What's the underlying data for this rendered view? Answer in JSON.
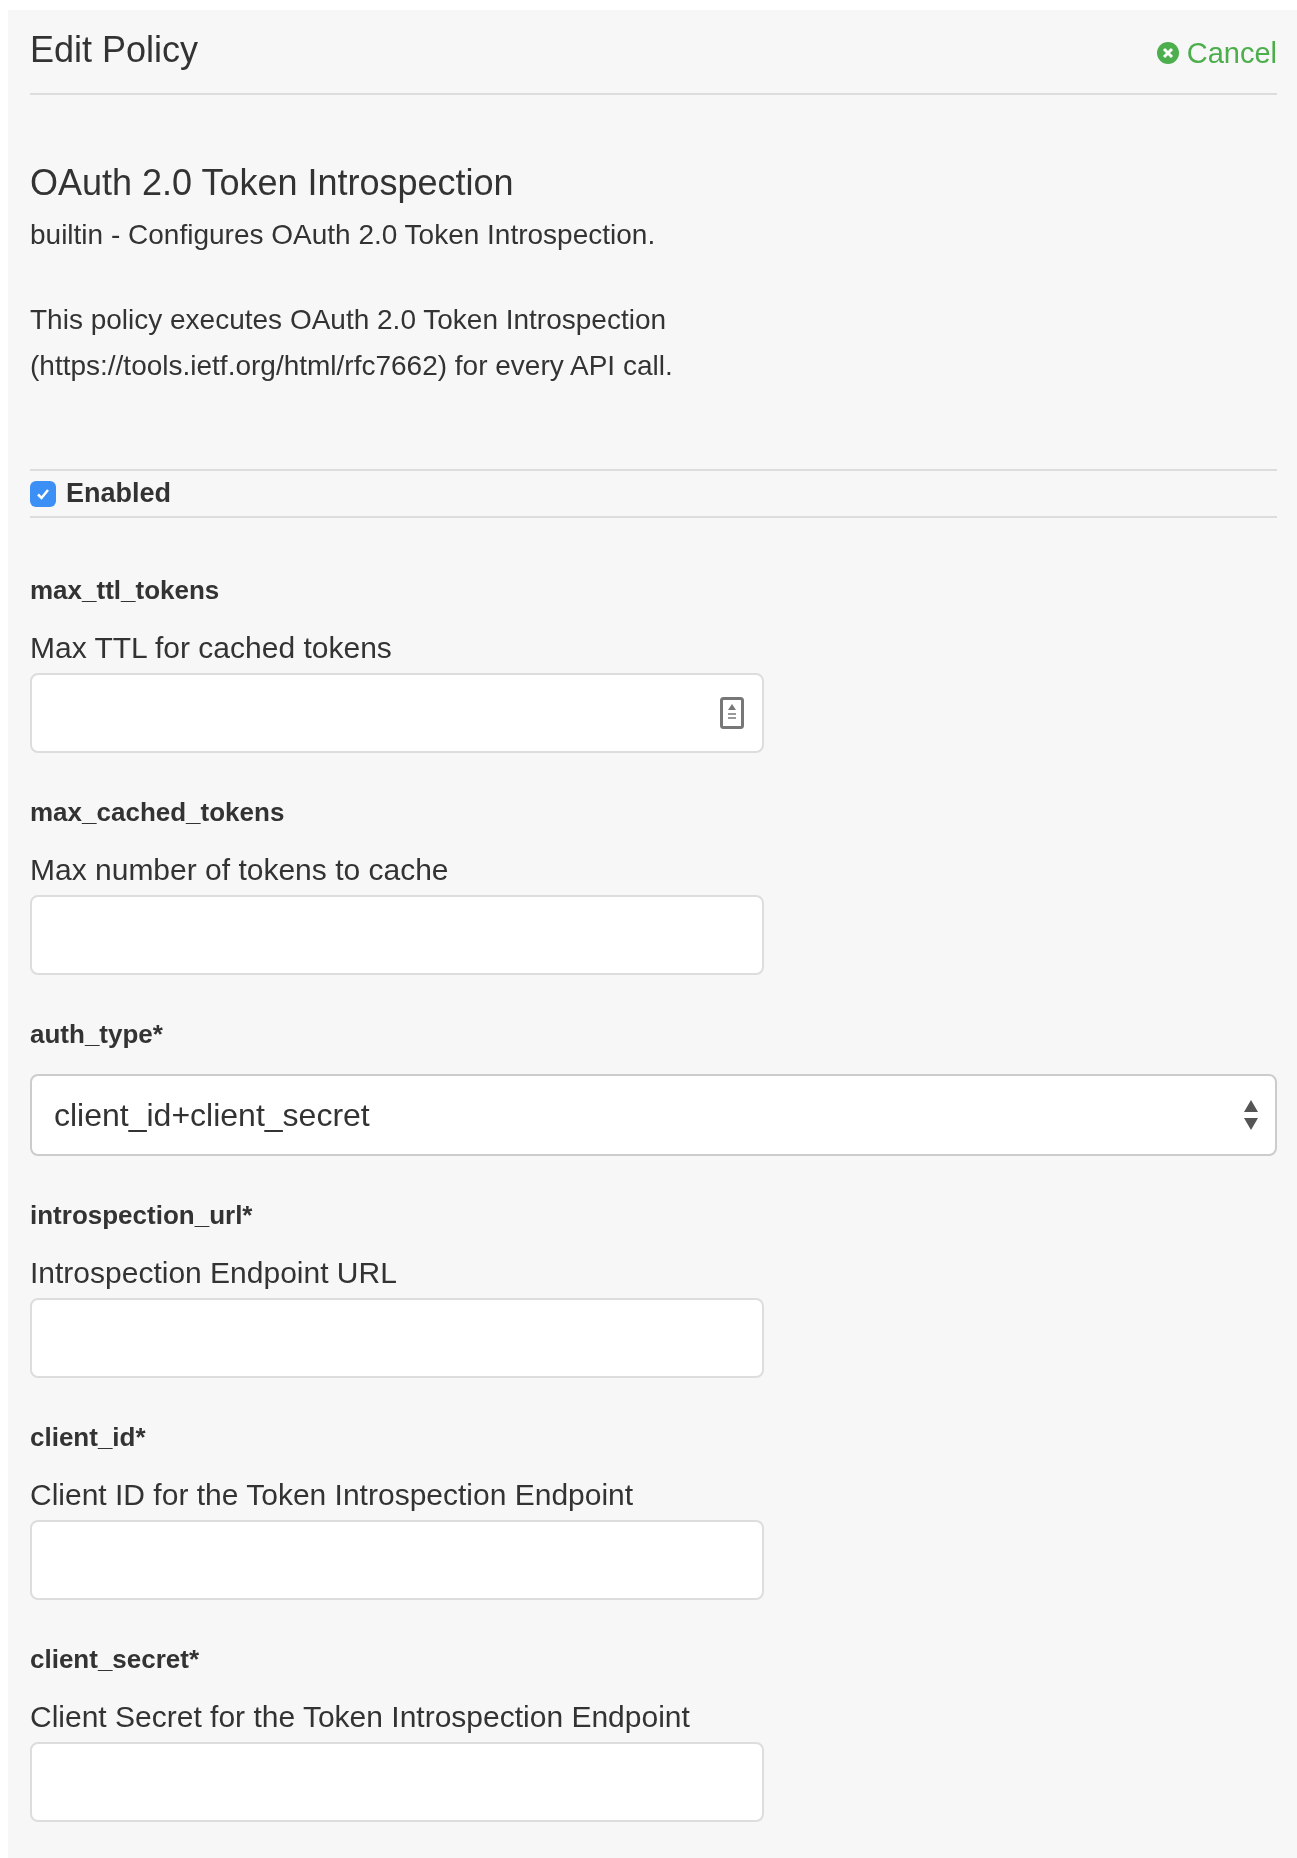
{
  "header": {
    "title": "Edit Policy",
    "cancel": "Cancel"
  },
  "policy": {
    "name": "OAuth 2.0 Token Introspection",
    "subtitle": "builtin - Configures OAuth 2.0 Token Introspection.",
    "description": "This policy executes OAuth 2.0 Token Introspection (https://tools.ietf.org/html/rfc7662) for every API call."
  },
  "enabled": {
    "label": "Enabled",
    "checked": true
  },
  "fields": [
    {
      "kind": "number",
      "label": "max_ttl_tokens",
      "description": "Max TTL for cached tokens"
    },
    {
      "kind": "text",
      "label": "max_cached_tokens",
      "description": "Max number of tokens to cache"
    },
    {
      "kind": "select",
      "label": "auth_type*",
      "value": "client_id+client_secret"
    },
    {
      "kind": "text",
      "label": "introspection_url*",
      "description": "Introspection Endpoint URL"
    },
    {
      "kind": "text",
      "label": "client_id*",
      "description": "Client ID for the Token Introspection Endpoint"
    },
    {
      "kind": "text",
      "label": "client_secret*",
      "description": "Client Secret for the Token Introspection Endpoint"
    }
  ]
}
